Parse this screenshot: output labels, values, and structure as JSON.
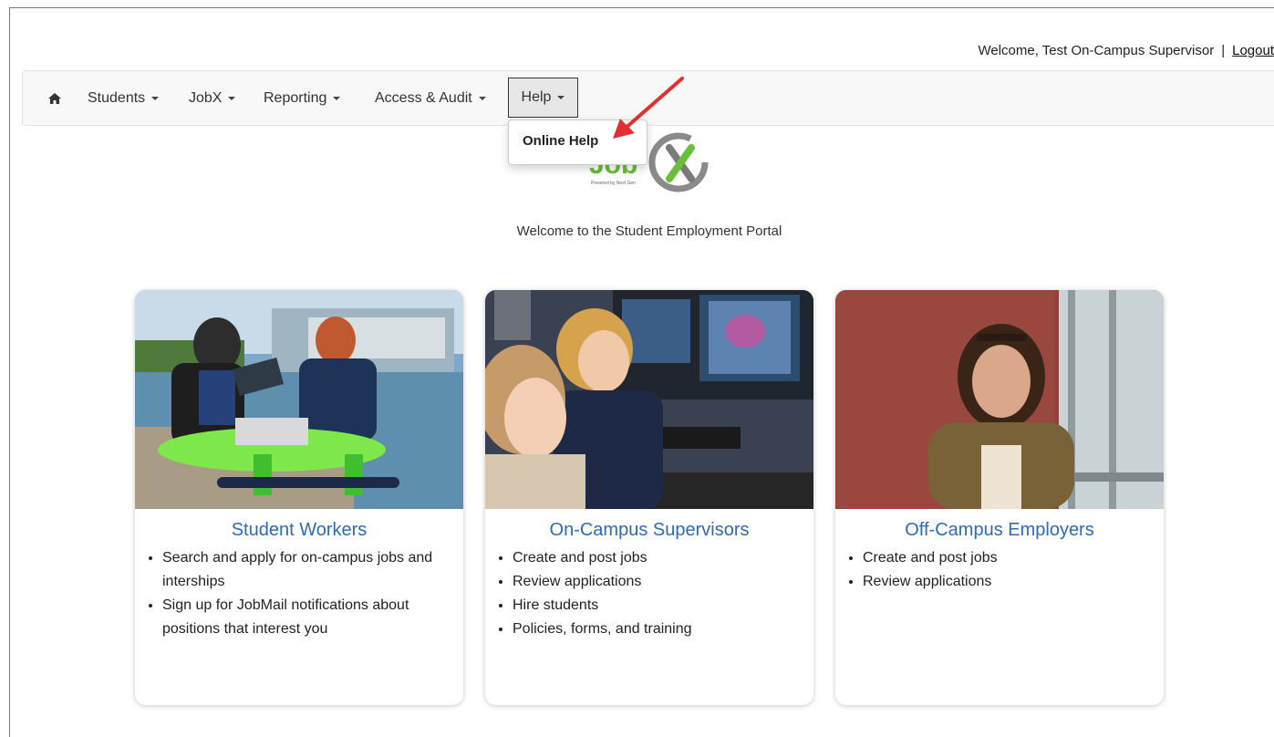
{
  "header": {
    "welcome_text": "Welcome, Test On-Campus Supervisor",
    "separator": "|",
    "logout_label": "Logout"
  },
  "nav": {
    "home_icon": "home-icon",
    "items": [
      {
        "label": "Students"
      },
      {
        "label": "JobX"
      },
      {
        "label": "Reporting"
      },
      {
        "label": "Access & Audit"
      },
      {
        "label": "Help"
      }
    ]
  },
  "help_menu": {
    "items": [
      {
        "label": "Online Help"
      }
    ]
  },
  "logo": {
    "tagline": "Powered by Next Gen"
  },
  "welcome_message": "Welcome to the Student Employment Portal",
  "cards": [
    {
      "title": "Student Workers",
      "bullets": [
        "Search and apply for on-campus jobs and interships",
        "Sign up for JobMail notifications about positions that interest you"
      ]
    },
    {
      "title": "On-Campus Supervisors",
      "bullets": [
        "Create and post jobs",
        "Review applications",
        "Hire students",
        "Policies, forms, and training"
      ]
    },
    {
      "title": "Off-Campus Employers",
      "bullets": [
        "Create and post jobs",
        "Review applications"
      ]
    }
  ],
  "colors": {
    "card_title": "#2d6bb3",
    "logo_green": "#6abf3a",
    "annotation_arrow": "#e03030"
  }
}
